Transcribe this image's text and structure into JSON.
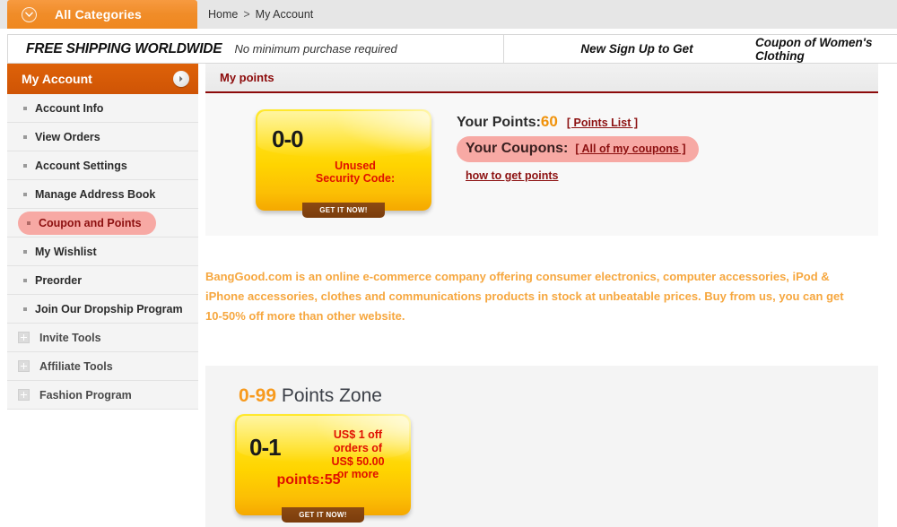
{
  "topbar": {
    "categories_label": "All Categories",
    "categories_icon": "chevron-down-circle-icon",
    "breadcrumb": {
      "home": "Home",
      "separator": ">",
      "current": "My Account"
    }
  },
  "promo_banner": {
    "headline": "FREE SHIPPING WORLDWIDE",
    "subtext": "No minimum purchase required",
    "right_1": "New Sign Up to Get",
    "right_2": "Coupon of Women's Clothing"
  },
  "sidebar": {
    "header": "My Account",
    "header_icon": "arrow-right-circle-icon",
    "items": [
      {
        "label": "Account Info",
        "type": "bullet",
        "active": false
      },
      {
        "label": "View Orders",
        "type": "bullet",
        "active": false
      },
      {
        "label": "Account Settings",
        "type": "bullet",
        "active": false
      },
      {
        "label": "Manage Address Book",
        "type": "bullet",
        "active": false
      },
      {
        "label": "Coupon and Points",
        "type": "bullet",
        "active": true
      },
      {
        "label": "My Wishlist",
        "type": "bullet",
        "active": false
      },
      {
        "label": "Preorder",
        "type": "bullet",
        "active": false
      },
      {
        "label": "Join Our Dropship Program",
        "type": "bullet",
        "active": false
      },
      {
        "label": "Invite Tools",
        "type": "expand",
        "active": false
      },
      {
        "label": "Affiliate Tools",
        "type": "expand",
        "active": false
      },
      {
        "label": "Fashion Program",
        "type": "expand",
        "active": false
      }
    ]
  },
  "main": {
    "panel_title": "My points",
    "coupon_card": {
      "code": "0-0",
      "description": "Unused\nSecurity Code:",
      "button_label": "GET IT NOW!"
    },
    "points": {
      "points_label": "Your Points:",
      "points_value": "60",
      "points_list_link": "[ Points List ]",
      "coupons_label": "Your Coupons:",
      "coupons_link": "[ All of my coupons ]",
      "how_to_link": "how to get points"
    },
    "promo_paragraph": "BangGood.com is an online e-commerce company offering consumer electronics, computer accessories, iPod & iPhone accessories, clothes and communications products in stock at unbeatable prices. Buy from us, you can get 10-50% off more than other website.",
    "zone": {
      "range": "0-99",
      "title_suffix": " Points Zone",
      "card": {
        "code": "0-1",
        "description": "US$ 1 off orders of US$ 50.00 or more",
        "points_text": "points:55",
        "button_label": "GET IT NOW!"
      }
    }
  },
  "colors": {
    "brand_orange": "#ef8820",
    "sidebar_header": "#d45806",
    "accent_red": "#8c0a0a",
    "highlight_pink": "#f7a9a4",
    "points_orange": "#f0920a",
    "promo_text_orange": "#f6a73f",
    "coupon_yellow": "#ffd400",
    "coupon_red_text": "#e01000"
  }
}
